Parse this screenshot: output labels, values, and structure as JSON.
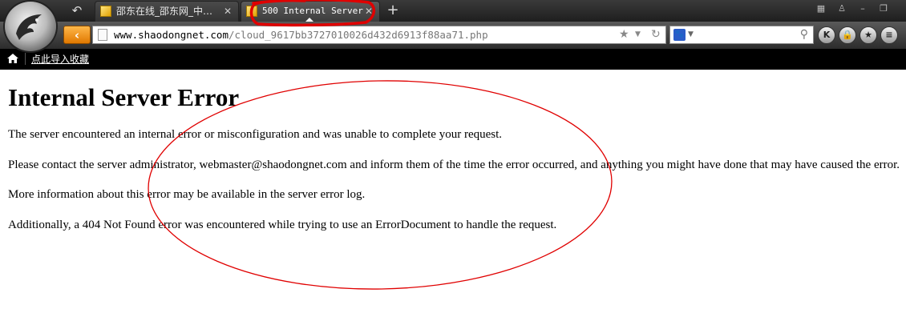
{
  "browser": {
    "tabs": [
      {
        "title": "邵东在线_邵东网_中…",
        "active": false
      },
      {
        "title": "500 Internal Server",
        "active": true
      }
    ],
    "new_tab": "+",
    "url_host": "www.shaodongnet.com",
    "url_path": "/cloud_9617bb3727010026d432d6913f88aa71.php",
    "bookmark_link": "点此导入收藏",
    "icons": [
      "browser-logo-icon",
      "back-icon",
      "favicon-icon",
      "close-icon",
      "new-tab-icon",
      "page-icon",
      "star-icon",
      "refresh-icon",
      "search-engine-icon",
      "search-icon",
      "home-icon"
    ],
    "annotation_color": "#e00000"
  },
  "page": {
    "heading": "Internal Server Error",
    "paragraphs": [
      "The server encountered an internal error or misconfiguration and was unable to complete your request.",
      "Please contact the server administrator, webmaster@shaodongnet.com and inform them of the time the error occurred, and anything you might have done that may have caused the error.",
      "More information about this error may be available in the server error log.",
      "Additionally, a 404 Not Found error was encountered while trying to use an ErrorDocument to handle the request."
    ]
  }
}
